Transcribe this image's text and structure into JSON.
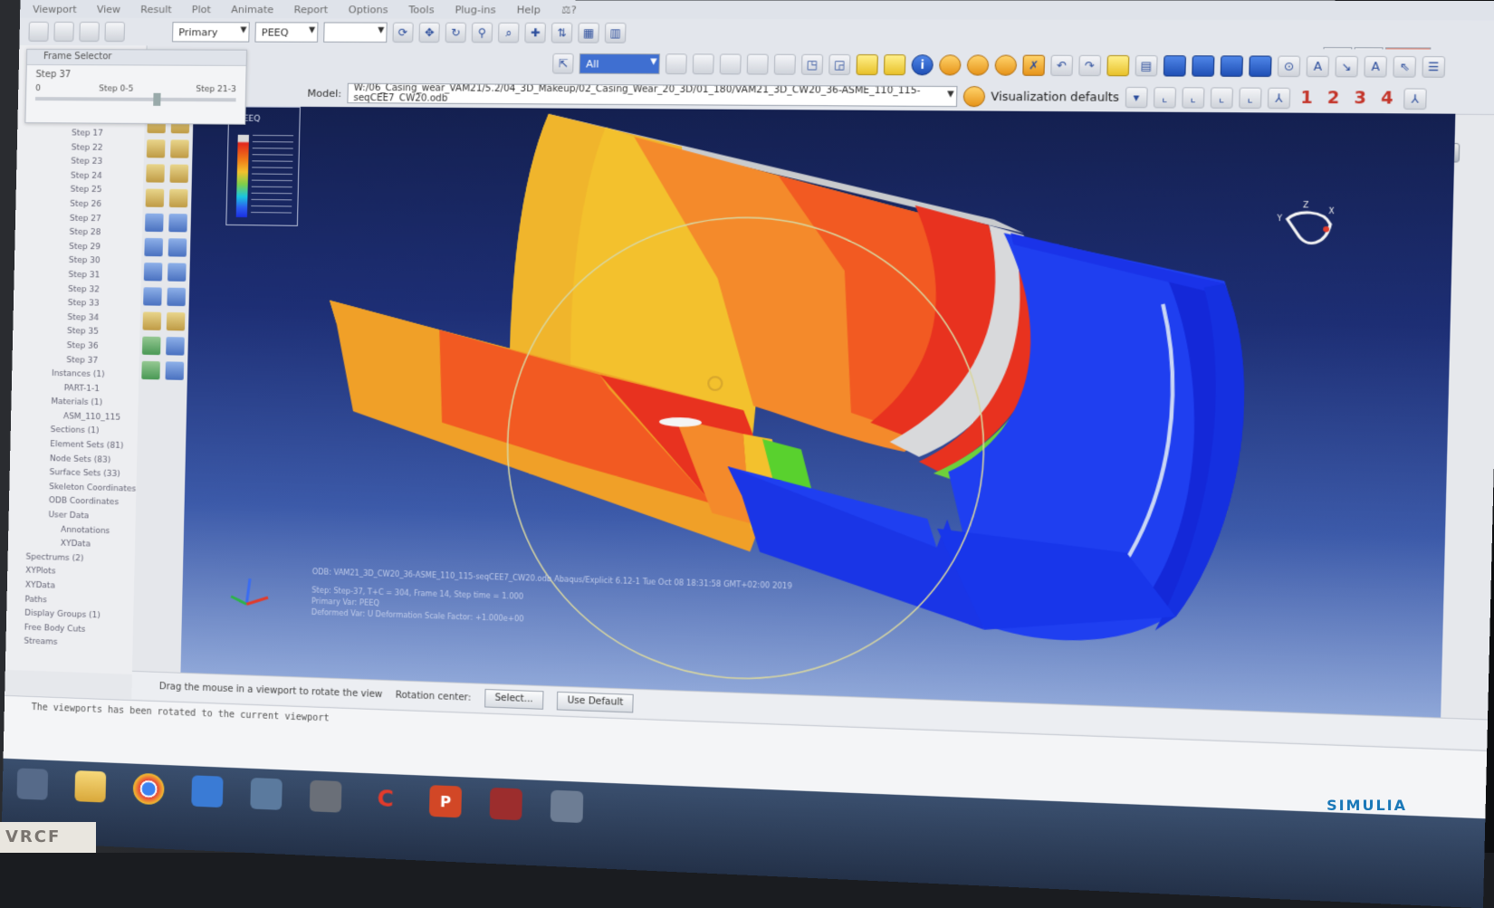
{
  "menubar": {
    "items": [
      "Viewport",
      "View",
      "Result",
      "Plot",
      "Animate",
      "Report",
      "Options",
      "Tools",
      "Plug-ins",
      "Help",
      "⚖?"
    ]
  },
  "toolbar1": {
    "primary_combo": "Primary",
    "field_combo": "PEEQ"
  },
  "toolbar2": {
    "all_combo": "All",
    "info_icon": "i"
  },
  "toolbar3": {
    "model_label": "Model:",
    "model_path": "W:/06_Casing_wear_VAM21/5.2/04_3D_Makeup/02_Casing_Wear_20_3D/01_180/VAM21_3D_CW20_36-ASME_110_115-seqCEE7_CW20.odb",
    "visualization_defaults": "Visualization defaults",
    "numbers": [
      "1",
      "2",
      "3",
      "4"
    ]
  },
  "frame_selector": {
    "title": "Frame Selector",
    "step": "Step 37",
    "range_left": "0",
    "range_mid": "Step 0-5",
    "range_right": "Step 21-3"
  },
  "tree": {
    "items": [
      "Step 17",
      "Step 22",
      "Step 23",
      "Step 24",
      "Step 25",
      "Step 26",
      "Step 27",
      "Step 28",
      "Step 29",
      "Step 30",
      "Step 31",
      "Step 32",
      "Step 33",
      "Step 34",
      "Step 35",
      "Step 36",
      "Step 37",
      "Instances (1)",
      "PART-1-1",
      "Materials (1)",
      "ASM_110_115",
      "Sections (1)",
      "Element Sets (81)",
      "Node Sets (83)",
      "Surface Sets (33)",
      "Skeleton Coordinates",
      "ODB Coordinates",
      "User Data",
      "Annotations",
      "XYData",
      "Spectrums (2)",
      "XYPlots",
      "XYData",
      "Paths",
      "Display Groups (1)",
      "Free Body Cuts",
      "Streams"
    ]
  },
  "viewport": {
    "legend_label": "PEEQ",
    "info_lines": [
      "ODB: VAM21_3D_CW20_36-ASME_110_115-seqCEE7_CW20.odb    Abaqus/Explicit 6.12-1    Tue Oct 08 18:31:58 GMT+02:00 2019",
      "Step: Step-37, T+C = 304, Frame 14, Step time = 1.000",
      "Primary Var: PEEQ",
      "Deformed Var: U  Deformation Scale Factor: +1.000e+00"
    ],
    "colors": {
      "gray": "#cfd1d3",
      "red": "#e8321f",
      "orange_red": "#f25a22",
      "orange": "#f4892a",
      "yellow": "#f3c12d",
      "green": "#59d12e",
      "cyan": "#27c7d9",
      "blue": "#1f3ff0",
      "background_top": "#142050"
    }
  },
  "prompt": {
    "instruction": "Drag the mouse in a viewport to rotate the view",
    "rotation_center_label": "Rotation center:",
    "select_button": "Select...",
    "default_button": "Use Default"
  },
  "message": {
    "text": "The viewports has been rotated to the current viewport"
  },
  "taskbar": {
    "apps": [
      "start",
      "folder",
      "chrome",
      "ie",
      "network",
      "tools",
      "C",
      "powerpoint",
      "settings",
      "misc"
    ]
  },
  "brand": "SIMULIA",
  "sticker_text": "VRCF"
}
